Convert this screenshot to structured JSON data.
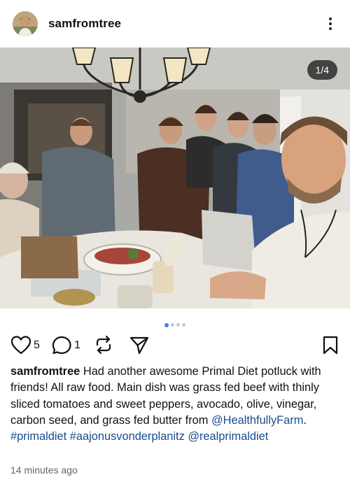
{
  "post": {
    "username": "samfromtree",
    "photo_counter": "1/4",
    "likes": "5",
    "comments": "1",
    "caption_user": "samfromtree",
    "caption_text": " Had another awesome Primal Diet potluck with friends! All raw food. Main dish was grass fed beef with thinly sliced tomatoes and sweet peppers, avocado, olive, vinegar, carbon seed, and grass fed butter from ",
    "caption_mention": "@HealthfullyFarm",
    "caption_period": ".",
    "hashtag_1": "#primaldiet",
    "hashtag_2": "#aajonusvonderplanitz",
    "mention_2": "@realprimaldiet",
    "timestamp": "14 minutes ago"
  },
  "icons": {
    "more": "more-vertical-icon",
    "like": "heart-icon",
    "comment": "comment-bubble-icon",
    "repost": "repost-icon",
    "share": "send-icon",
    "save": "bookmark-icon"
  },
  "carousel": {
    "pages": 4,
    "active_index": 0
  },
  "colors": {
    "link": "#1a4b8c",
    "active_dot": "#3b82f6",
    "text": "#111111",
    "muted": "#666666"
  }
}
